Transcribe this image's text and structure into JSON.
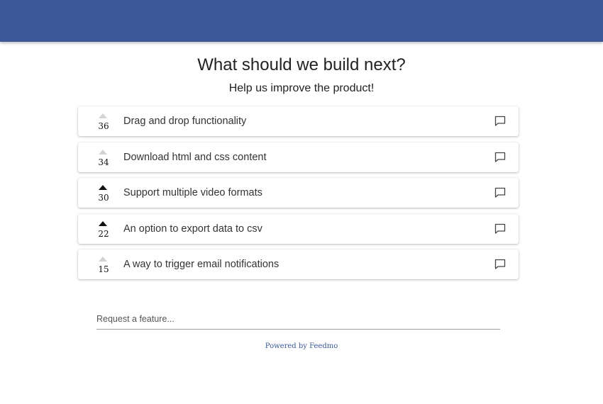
{
  "header": {
    "color": "#3b5998"
  },
  "title": "What should we build next?",
  "subtitle": "Help us improve the product!",
  "features": [
    {
      "votes": "36",
      "label": "Drag and drop functionality",
      "voted": false
    },
    {
      "votes": "34",
      "label": "Download html and css content",
      "voted": false
    },
    {
      "votes": "30",
      "label": "Support multiple video formats",
      "voted": true
    },
    {
      "votes": "22",
      "label": "An option to export data to csv",
      "voted": true
    },
    {
      "votes": "15",
      "label": "A way to trigger email notifications",
      "voted": false
    }
  ],
  "request_input": {
    "placeholder": "Request a feature...",
    "value": ""
  },
  "footer": {
    "powered_by": "Powered by Feedmo"
  }
}
